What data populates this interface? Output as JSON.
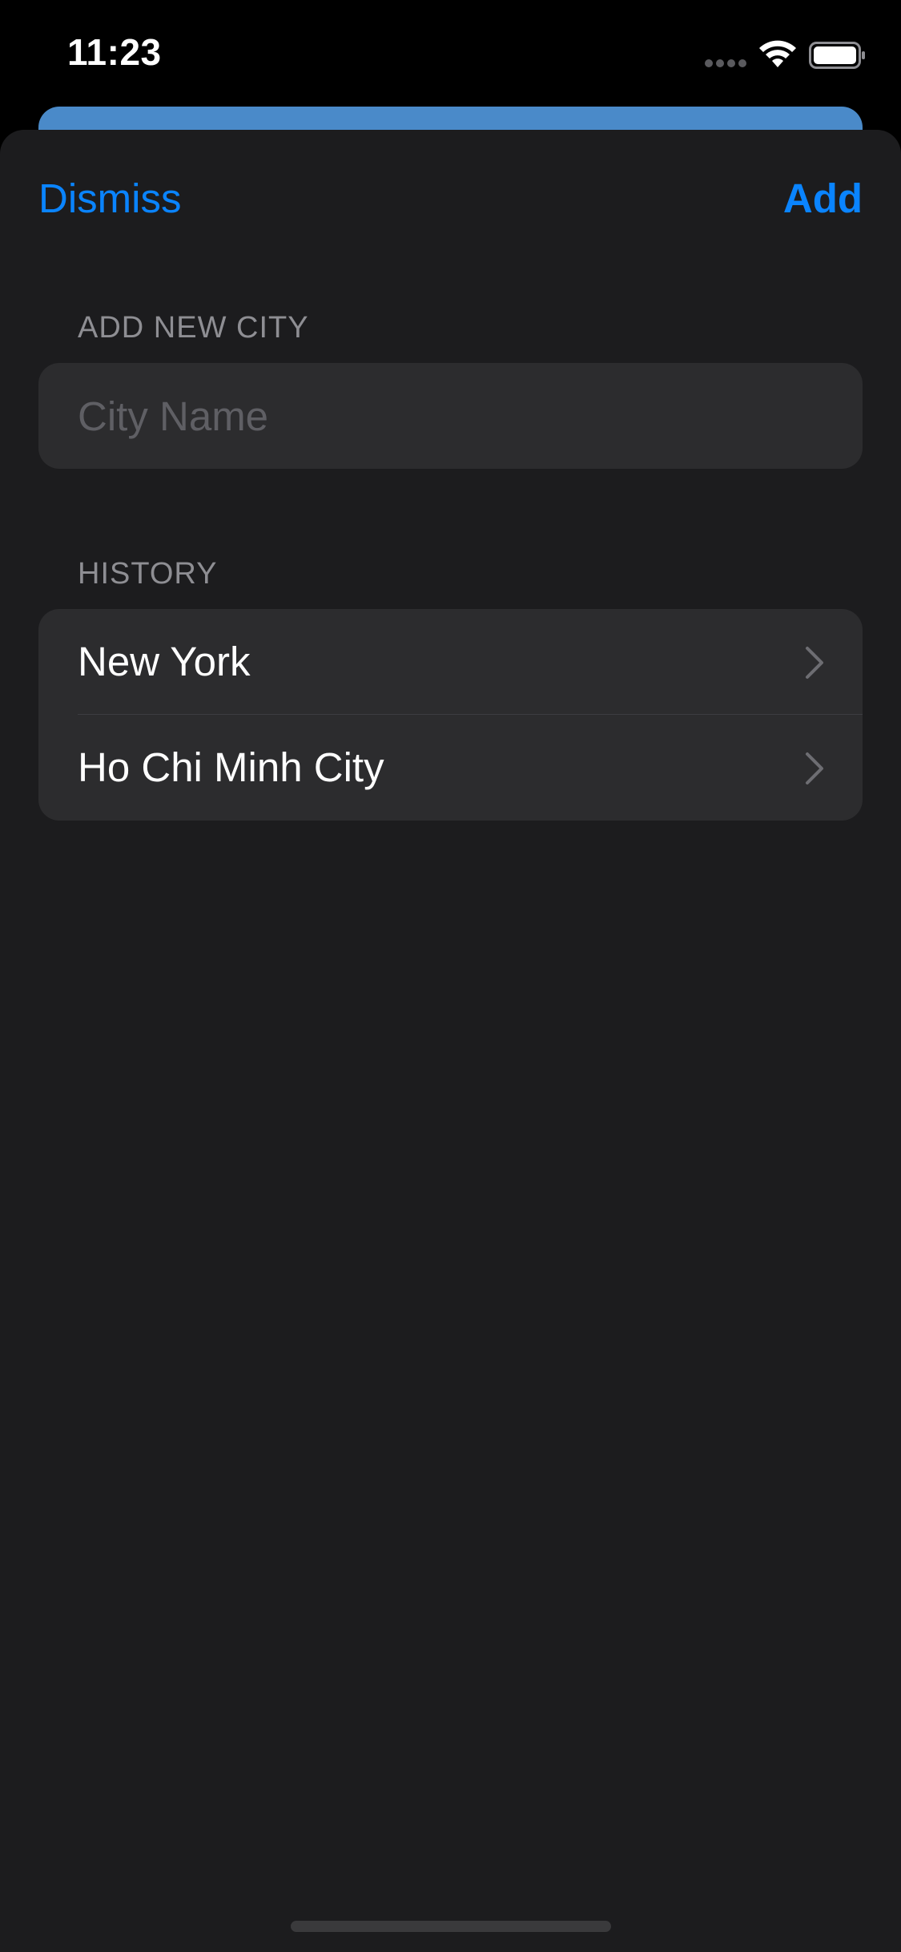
{
  "status_bar": {
    "time": "11:23",
    "signal_icon": "cellular-signal-icon",
    "wifi_icon": "wifi-icon",
    "battery_icon": "battery-icon"
  },
  "nav": {
    "dismiss_label": "Dismiss",
    "add_label": "Add"
  },
  "add_section": {
    "header": "ADD NEW CITY",
    "input_placeholder": "City Name",
    "input_value": ""
  },
  "history_section": {
    "header": "HISTORY",
    "items": [
      {
        "label": "New York"
      },
      {
        "label": "Ho Chi Minh City"
      }
    ]
  },
  "colors": {
    "accent": "#0a84ff",
    "sheet_background": "#1c1c1e",
    "group_background": "#2c2c2e",
    "secondary_text": "#8e8e93",
    "peek_sheet": "#4a8ac9"
  }
}
